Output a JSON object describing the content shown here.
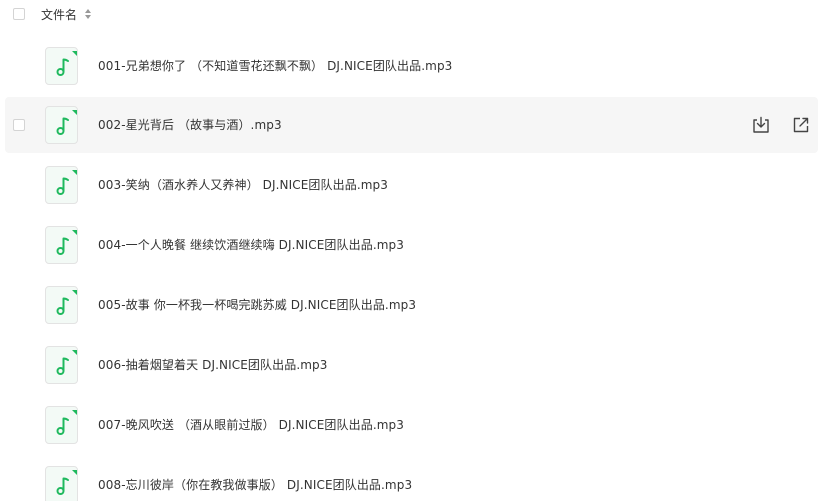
{
  "header": {
    "column_label": "文件名"
  },
  "files": [
    {
      "name": "001-兄弟想你了 （不知道雪花还飘不飘） DJ.NICE团队出品.mp3",
      "icon": "music-note-icon"
    },
    {
      "name": "002-星光背后 （故事与酒）.mp3",
      "icon": "music-note-icon",
      "hovered": true
    },
    {
      "name": "003-笑纳（酒水养人又养神） DJ.NICE团队出品.mp3",
      "icon": "music-note-icon"
    },
    {
      "name": "004-一个人晚餐  继续饮酒继续嗨 DJ.NICE团队出品.mp3",
      "icon": "music-note-icon"
    },
    {
      "name": "005-故事  你一杯我一杯喝完跳苏威 DJ.NICE团队出品.mp3",
      "icon": "music-note-icon"
    },
    {
      "name": "006-抽着烟望着天  DJ.NICE团队出品.mp3",
      "icon": "music-note-icon"
    },
    {
      "name": "007-晚风吹送 （酒从眼前过版） DJ.NICE团队出品.mp3",
      "icon": "music-note-icon"
    },
    {
      "name": "008-忘川彼岸（你在教我做事版） DJ.NICE团队出品.mp3",
      "icon": "music-note-icon"
    }
  ],
  "row_actions": {
    "download_icon": "download-icon",
    "open_icon": "external-link-icon"
  },
  "colors": {
    "accent_green": "#1fb95e",
    "hover_bg": "#f6f6f6",
    "text": "#333333"
  }
}
